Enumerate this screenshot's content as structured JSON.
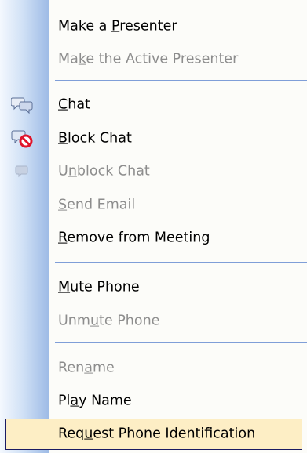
{
  "menu": {
    "items": [
      {
        "pre": "Make a ",
        "ul": "P",
        "post": "resenter",
        "enabled": true
      },
      {
        "pre": "Ma",
        "ul": "k",
        "post": "e the Active Presenter",
        "enabled": false
      },
      {
        "pre": "",
        "ul": "C",
        "post": "hat",
        "enabled": true,
        "icon": "chat-bubbles-icon"
      },
      {
        "pre": "",
        "ul": "B",
        "post": "lock Chat",
        "enabled": true,
        "icon": "block-chat-icon"
      },
      {
        "pre": "U",
        "ul": "n",
        "post": "block Chat",
        "enabled": false,
        "icon": "unblock-chat-icon"
      },
      {
        "pre": "",
        "ul": "S",
        "post": "end Email",
        "enabled": false
      },
      {
        "pre": "",
        "ul": "R",
        "post": "emove from Meeting",
        "enabled": true
      },
      {
        "pre": "",
        "ul": "M",
        "post": "ute Phone",
        "enabled": true
      },
      {
        "pre": "Unm",
        "ul": "u",
        "post": "te Phone",
        "enabled": false
      },
      {
        "pre": "Ren",
        "ul": "a",
        "post": "me",
        "enabled": false
      },
      {
        "pre": "Pl",
        "ul": "a",
        "post": "y Name",
        "enabled": true
      },
      {
        "pre": "Req",
        "ul": "u",
        "post": "est Phone Identification",
        "enabled": true,
        "highlighted": true
      }
    ]
  },
  "colors": {
    "highlight": "#fdeec5",
    "highlight_border": "#1b1b63",
    "separator": "#7f9ed8",
    "disabled_text": "#8d8d8d"
  }
}
